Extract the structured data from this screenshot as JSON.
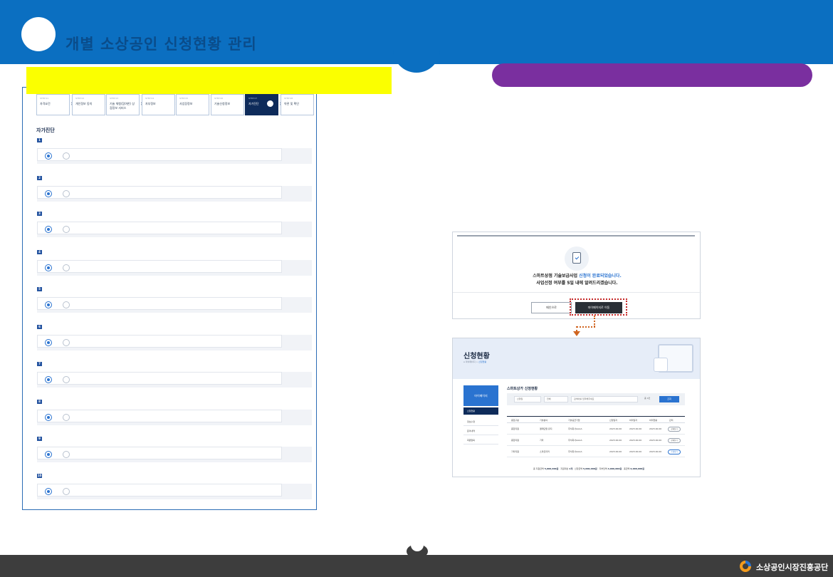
{
  "header": {
    "title": "개별 소상공인 신청현황 관리"
  },
  "left_screen": {
    "section_title": "자가진단",
    "steps": [
      {
        "small": "STEP 01",
        "big": "자격요건"
      },
      {
        "small": "STEP 02",
        "big": "개인정보 동의"
      },
      {
        "small": "STEP 03",
        "big": "기술 체험(참여한) 상점정보 서비스"
      },
      {
        "small": "STEP 04",
        "big": "자부정보"
      },
      {
        "small": "STEP 05",
        "big": "사업장정보"
      },
      {
        "small": "STEP 06",
        "big": "기술신청정보"
      },
      {
        "small": "STEP 07",
        "big": "자가진단"
      },
      {
        "small": "STEP 08",
        "big": "약관 및 확인"
      }
    ],
    "active_step": 7,
    "questions": [
      "1",
      "2",
      "3",
      "4",
      "5",
      "6",
      "7",
      "8",
      "9",
      "10"
    ]
  },
  "complete_screen": {
    "message_prefix": "스마트상점 기술보급사업 ",
    "message_highlight": "신청이 완료되었습니다.",
    "message_line2": "사업선정 여부를 5일 내에 알려드리겠습니다.",
    "btn_secondary": "메인으로",
    "btn_primary": "마이페이지로 이동"
  },
  "status_screen": {
    "title": "신청현황",
    "breadcrumb_home": "마이페이지",
    "breadcrumb_current": "신청현황",
    "side_head": "마이페이지",
    "side_items": [
      "신청현황",
      "정보수정",
      "문의내역",
      "회원탈퇴"
    ],
    "heading": "스마트상가 신청현황",
    "filter_select1": "신청일",
    "filter_select2": "전체",
    "filter_input": "검색어를 입력해주세요",
    "filter_count": "총 0건",
    "search_btn": "조회",
    "columns": [
      "종합구분",
      "기술분야",
      "기술공급기업",
      "신청일자",
      "처리일자",
      "처리현황",
      "관리"
    ],
    "rows": [
      [
        "종합지원",
        "결제단말 유지",
        "주식회사AAAA",
        "2023.00.00",
        "2023.00.00",
        "2023.00.00",
        "상세보기"
      ],
      [
        "종합지원",
        "기타",
        "주식회사AAAA",
        "2023.00.00",
        "2023.00.00",
        "2023.00.00",
        "상세보기"
      ],
      [
        "기타지원",
        "스마트미러",
        "주식회사AAAA",
        "2023.00.00",
        "2023.00.00",
        "2023.00.00",
        "수정하기"
      ]
    ],
    "total_labels": [
      "총 지원금액",
      "지원대상",
      "신청금액",
      "자부담액",
      "총금액"
    ],
    "total_values": [
      "5,000,000원",
      "1개",
      "5,000,000원",
      "4,000,000원",
      "9,000,000원"
    ]
  },
  "footer": {
    "org": "소상공인시장진흥공단"
  },
  "colors": {
    "header_blue": "#0b6fc1",
    "highlight_yellow": "#fbff00",
    "pill_purple": "#7a2f9f",
    "footer_dark": "#3d3d3d"
  }
}
